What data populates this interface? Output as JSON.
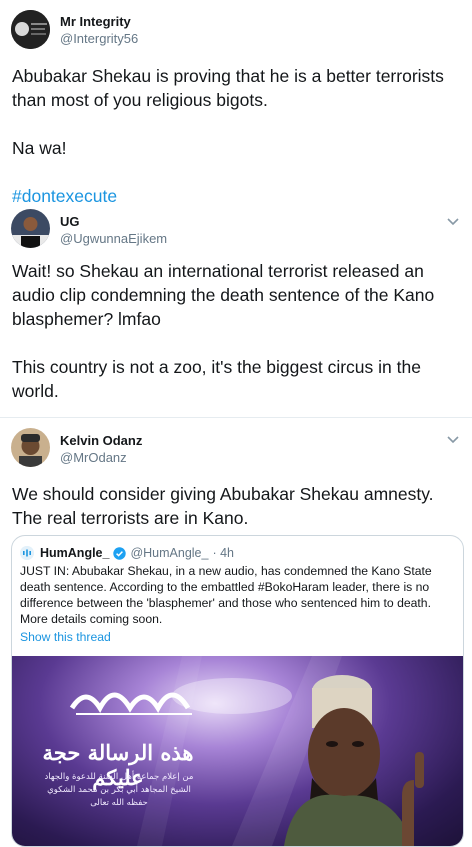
{
  "tweets": [
    {
      "name": "Mr Integrity",
      "handle": "@Intergrity56",
      "lines": [
        "Abubakar Shekau is proving that he is a better terrorists than most of you religious bigots.",
        "Na wa!"
      ],
      "hashtag": "#dontexecute"
    },
    {
      "name": "UG",
      "handle": "@UgwunnaEjikem",
      "lines": [
        "Wait! so Shekau an international terrorist released an audio clip condemning the death sentence of the Kano blasphemer? lmfao",
        "This country is not a zoo, it's the biggest circus in the world."
      ]
    },
    {
      "name": "Kelvin Odanz",
      "handle": "@MrOdanz",
      "lines": [
        "We should consider giving Abubakar Shekau amnesty. The real terrorists are in Kano."
      ]
    }
  ],
  "quote": {
    "name": "HumAngle_",
    "handle": "@HumAngle_",
    "time": "· 4h",
    "text": "JUST IN: Abubakar Shekau, in a new audio, has condemned the Kano State death sentence. According to the embattled #BokoHaram leader, there is no difference between the 'blasphemer' and those who sentenced him to death. More details coming soon.",
    "show_thread": "Show this thread",
    "image": {
      "arabic_title": "هذه الرسالة حجة عليكم",
      "arabic_line1": "من إعلام جماعة أهل السنة للدعوة والجهاد",
      "arabic_line2": "الشيخ المجاهد أبي بكر بن محمد الشكوي",
      "arabic_line3": "حفظه الله تعالى"
    }
  },
  "colors": {
    "link": "#1b95e0",
    "divider": "#e6ecf0",
    "secondary_text": "#657786"
  },
  "icons": {
    "caret": "chevron-down-icon",
    "verified": "verified-badge-icon",
    "source_logo": "humangle-logo-icon"
  }
}
